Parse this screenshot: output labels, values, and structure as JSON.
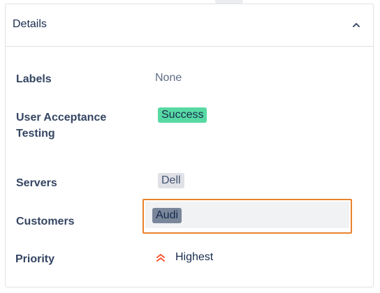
{
  "panel": {
    "title": "Details",
    "collapse_icon": "chevron-up-icon"
  },
  "fields": {
    "labels": {
      "label": "Labels",
      "value": "None"
    },
    "uat": {
      "label_line1": "User Acceptance",
      "label_line2": "Testing",
      "value": "Success",
      "value_color": "#57d9a3"
    },
    "servers": {
      "label": "Servers",
      "value": "Dell"
    },
    "customers": {
      "label": "Customers",
      "value": "Audi",
      "focus_color": "#e9822c"
    },
    "priority": {
      "label": "Priority",
      "value": "Highest",
      "icon": "priority-highest-icon",
      "icon_color": "#ff5630"
    }
  }
}
